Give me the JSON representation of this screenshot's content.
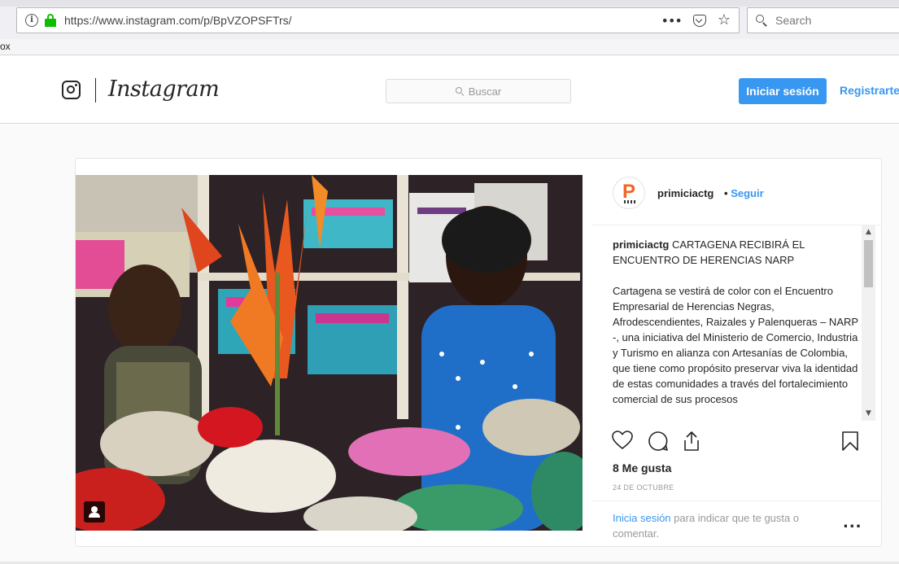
{
  "browser": {
    "url": "https://www.instagram.com/p/BpVZOPSFTrs/",
    "search_placeholder": "Search",
    "bookmark_fragment": "ox"
  },
  "header": {
    "wordmark": "Instagram",
    "search_placeholder": "Buscar",
    "login_label": "Iniciar sesión",
    "register_label": "Registrarte"
  },
  "post": {
    "owner": "primiciactg",
    "separator": "•",
    "follow_label": "Seguir",
    "caption_user": "primiciactg",
    "caption_title": "CARTAGENA RECIBIRÁ EL ENCUENTRO DE HERENCIAS NARP",
    "caption_body": "Cartagena se vestirá de color con el Encuentro Empresarial de Herencias Negras, Afrodescendientes, Raizales y Palenqueras – NARP -, una iniciativa del Ministerio de Comercio, Industria y Turismo en alianza con Artesanías de Colombia, que tiene como propósito preservar viva la identidad de estas comunidades a través del fortalecimiento comercial de sus procesos",
    "likes": "8 Me gusta",
    "date": "24 DE OCTUBRE",
    "login_link": "Inicia sesión",
    "login_rest": " para indicar que te gusta o comentar.",
    "more": "...",
    "avatar_letter": "P"
  },
  "colors": {
    "accent": "#3897f0",
    "lock_green": "#12bc00",
    "avatar_orange": "#f26522"
  },
  "icons": [
    "info-icon",
    "lock-icon",
    "page-actions-icon",
    "pocket-icon",
    "star-icon",
    "search-icon",
    "instagram-glyph-icon",
    "heart-icon",
    "comment-icon",
    "share-icon",
    "save-icon",
    "tagged-user-icon",
    "more-icon"
  ]
}
